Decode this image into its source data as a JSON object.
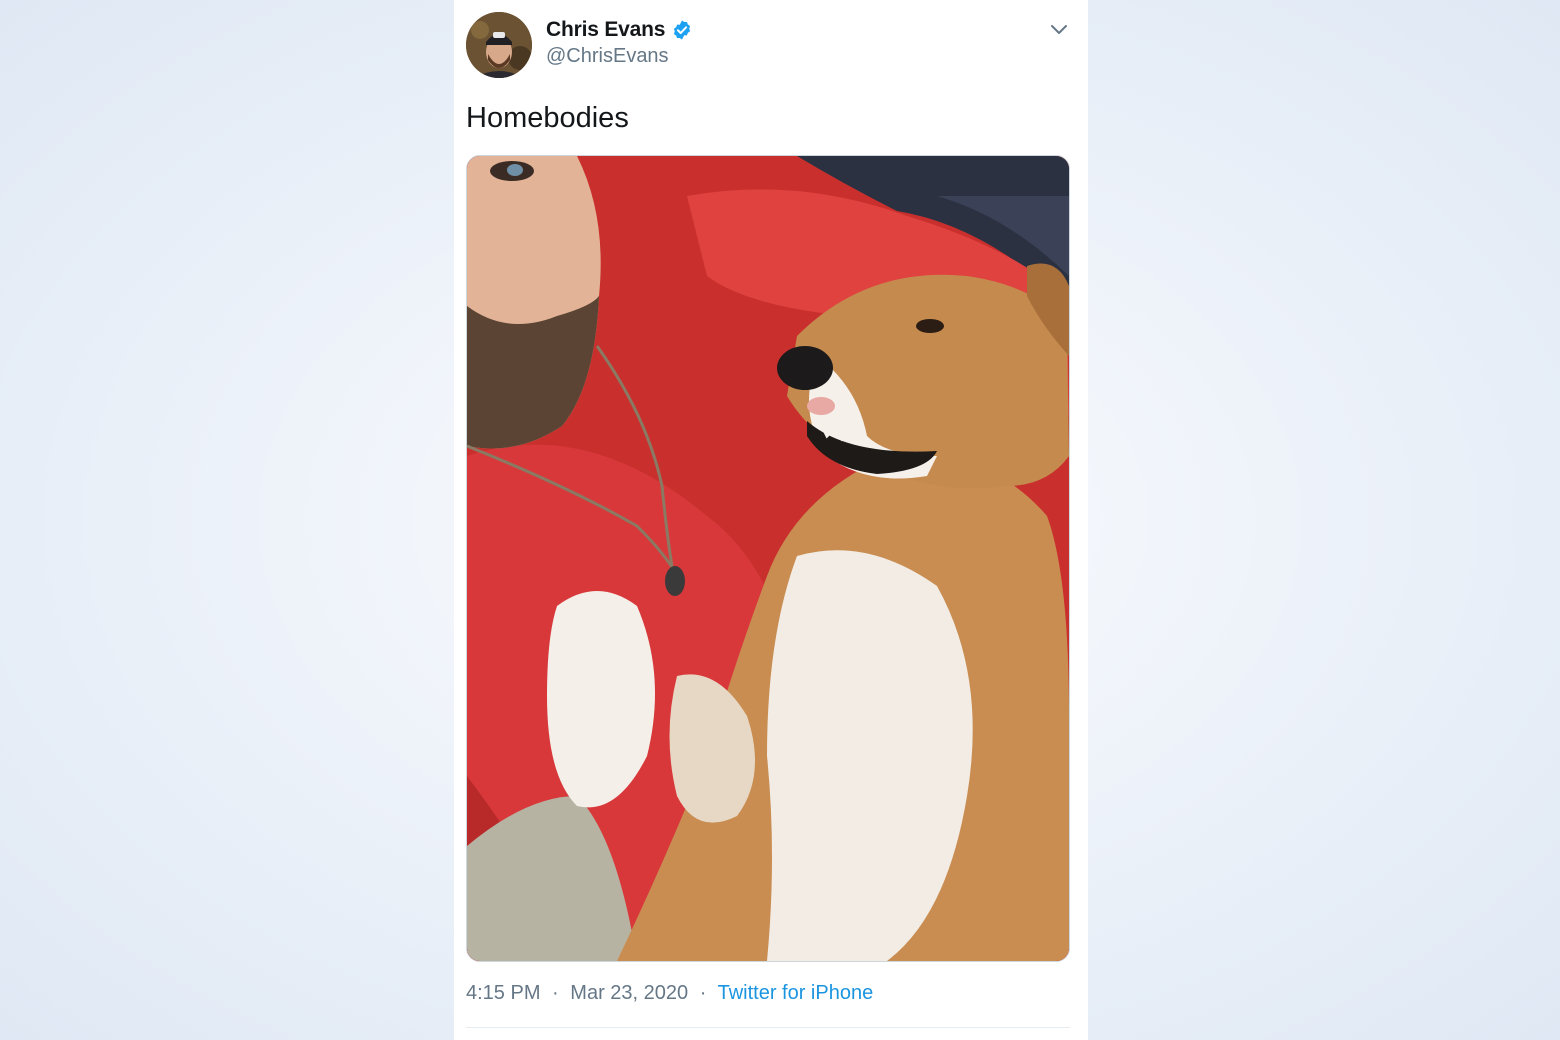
{
  "tweet": {
    "author": {
      "name": "Chris Evans",
      "handle": "@ChrisEvans",
      "verified": true,
      "avatar_icon": "profile-photo"
    },
    "text": "Homebodies",
    "media": {
      "kind": "photo",
      "icon": "photo-man-and-dog"
    },
    "time": "4:15 PM",
    "date": "Mar 23, 2020",
    "separator": "·",
    "source": "Twitter for iPhone"
  },
  "icons": {
    "verified": "verified-badge-icon",
    "menu": "chevron-down-icon"
  },
  "colors": {
    "link": "#1b95e0",
    "verified": "#1da1f2",
    "secondary_text": "#657786",
    "primary_text": "#14171a"
  }
}
